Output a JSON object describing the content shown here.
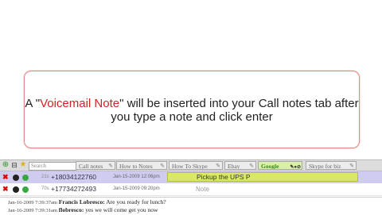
{
  "callout": {
    "line1_pre": "A \"",
    "line1_highlight": "Voicemail Note",
    "line1_post": "\" will be inserted into your Call notes tab after",
    "line2": "you type a note and click enter"
  },
  "toolbar": {
    "search_placeholder": "Search",
    "tabs": [
      {
        "label": "Call notes"
      },
      {
        "label": "How to Notes"
      },
      {
        "label": "How To Skype"
      },
      {
        "label": "Ebay"
      },
      {
        "label": "Google"
      },
      {
        "label": "Skype for biz"
      }
    ]
  },
  "calls": [
    {
      "duration": "21s",
      "number": "+18034122760",
      "date": "Jan-15-2009 12:06pm",
      "note": "Pickup the UPS P",
      "note_placeholder": ""
    },
    {
      "duration": "70s",
      "number": "+17734272493",
      "date": "Jan-15-2009 09:20pm",
      "note": "",
      "note_placeholder": "Note"
    }
  ],
  "chat": [
    {
      "time": "Jan-16-2009 7:39:37am",
      "name": "Francis Lobresco:",
      "text": " Are you ready for lunch?"
    },
    {
      "time": "Jan-16-2009 7:39:31am",
      "name": "flobresco:",
      "text": " yes we will come get you now"
    }
  ],
  "colors": {
    "accent": "#d32222",
    "selected_row": "#d0ccf0",
    "note_input": "#d8e86a",
    "active_tab": "#d8f0a8"
  }
}
